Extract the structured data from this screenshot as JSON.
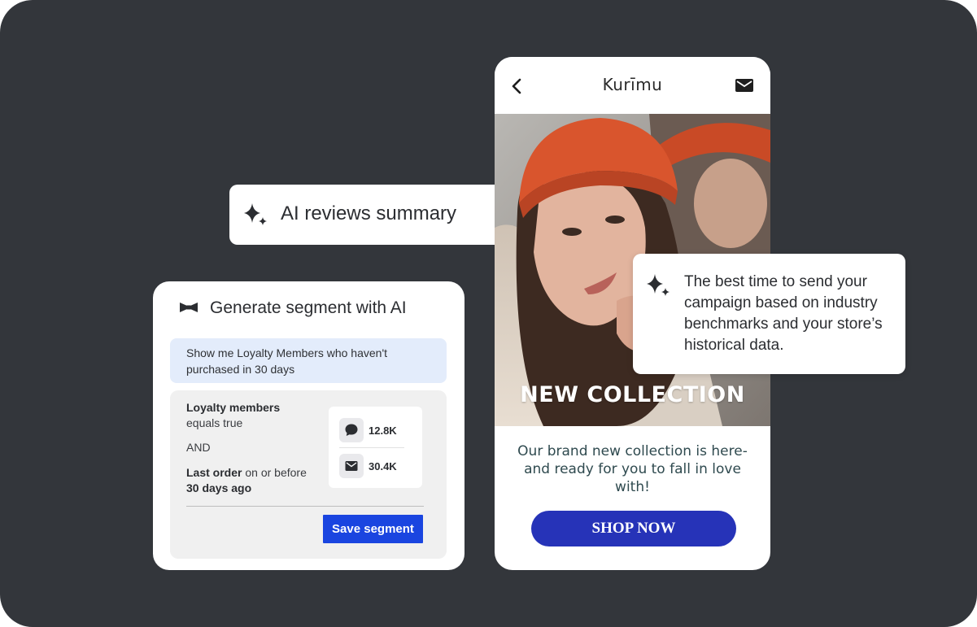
{
  "phone": {
    "brand": "Kurīmu",
    "hero_title": "NEW COLLECTION",
    "promo_text": "Our brand new collection is here- and ready for you to fall in love with!",
    "shop_button": "SHOP NOW",
    "icons": {
      "back": "chevron-left-icon",
      "mail": "mail-icon"
    }
  },
  "reviews_card": {
    "label": "AI reviews summary",
    "icon": "sparkle-icon"
  },
  "best_time_card": {
    "text": "The best time to send your campaign based on industry benchmarks and your store’s historical data.",
    "icon": "sparkle-icon"
  },
  "segment_card": {
    "title": "Generate segment with AI",
    "icon": "bowtie-icon",
    "prompt": "Show me Loyalty Members who haven't purchased in 30 days",
    "criteria": {
      "line1_bold": "Loyalty members",
      "line1_rest": "equals true",
      "operator": "AND",
      "line2_bold": "Last order",
      "line2_mid": " on or before ",
      "line2_bold2": "30 days ago"
    },
    "stats": [
      {
        "icon": "chat-bubble-icon",
        "value": "12.8K"
      },
      {
        "icon": "mail-icon",
        "value": "30.4K"
      }
    ],
    "save_button": "Save segment"
  },
  "colors": {
    "background": "#33363b",
    "shop_button": "#2633b8",
    "save_button": "#1a45e0",
    "prompt_bg": "#e3ecfb",
    "beanie": "#d9552d"
  }
}
